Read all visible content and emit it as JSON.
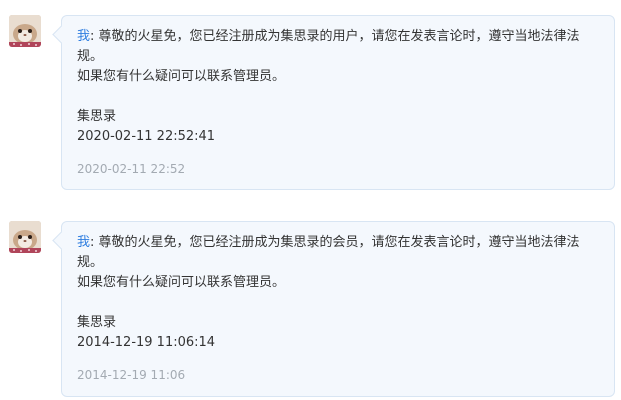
{
  "messages": [
    {
      "sender": "我",
      "text_line1": ": 尊敬的火星免，您已经注册成为集思录的用户，请您在发表言论时，遵守当地法律法",
      "text_line2": "规。",
      "text_line3": "如果您有什么疑问可以联系管理员。",
      "signature": "集思录",
      "sent_datetime": "2020-02-11 22:52:41",
      "timestamp": "2020-02-11 22:52",
      "avatar_icon": "hamster-avatar-icon"
    },
    {
      "sender": "我",
      "text_line1": ": 尊敬的火星免，您已经注册成为集思录的会员，请您在发表言论时，遵守当地法律法",
      "text_line2": "规。",
      "text_line3": "如果您有什么疑问可以联系管理员。",
      "signature": "集思录",
      "sent_datetime": "2014-12-19 11:06:14",
      "timestamp": "2014-12-19 11:06",
      "avatar_icon": "hamster-avatar-icon"
    }
  ],
  "colors": {
    "bubble_bg": "#f4f8fd",
    "bubble_border": "#d8e5f3",
    "sender_link": "#2f7ee0",
    "timestamp": "#a3aab2",
    "text": "#333333"
  }
}
